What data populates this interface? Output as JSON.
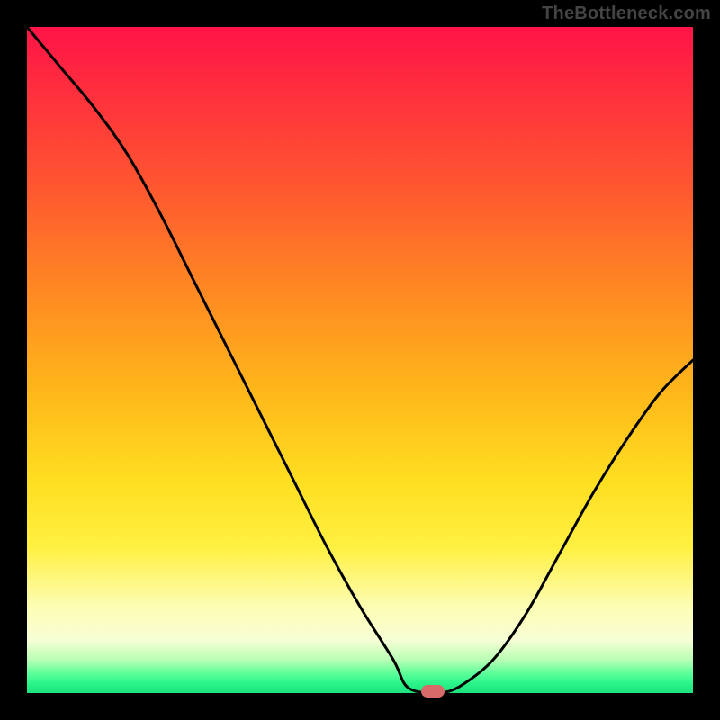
{
  "watermark": "TheBottleneck.com",
  "chart_data": {
    "type": "line",
    "title": "",
    "xlabel": "",
    "ylabel": "",
    "xlim": [
      0,
      100
    ],
    "ylim": [
      0,
      100
    ],
    "grid": false,
    "legend": false,
    "x": [
      0,
      5,
      10,
      15,
      20,
      25,
      30,
      35,
      40,
      45,
      50,
      55,
      57,
      60,
      62,
      65,
      70,
      75,
      80,
      85,
      90,
      95,
      100
    ],
    "y": [
      100,
      94,
      88,
      81,
      72,
      62,
      52,
      42,
      32,
      22,
      13,
      5,
      1,
      0,
      0,
      1,
      5,
      12,
      21,
      30,
      38,
      45,
      50
    ],
    "marker": {
      "x": 61,
      "y": 0
    },
    "background_gradient": [
      "#ff1347",
      "#ff5a2f",
      "#ffb81a",
      "#fff040",
      "#f7ffd6",
      "#2bf58a"
    ]
  },
  "colors": {
    "curve": "#000000",
    "marker": "#d86a6a",
    "frame": "#000000"
  }
}
